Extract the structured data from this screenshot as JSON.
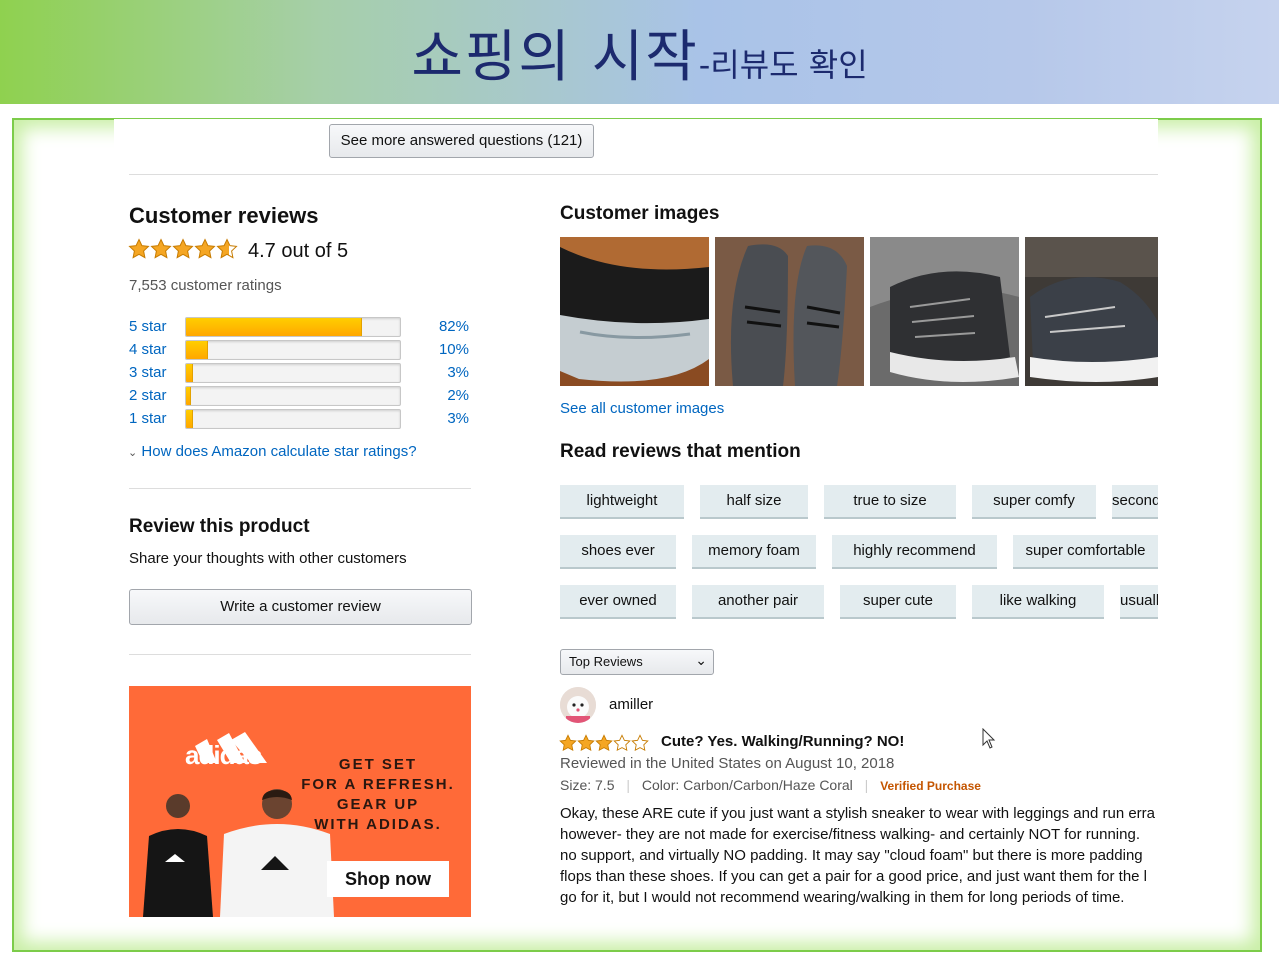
{
  "banner": {
    "title_main": "쇼핑의 시작",
    "title_sub": "-리뷰도 확인"
  },
  "qa": {
    "button_label": "See more answered questions (121)"
  },
  "reviews": {
    "heading": "Customer reviews",
    "rating_text": "4.7 out of 5",
    "rating_value": 4.7,
    "ratings_count": "7,553 customer ratings",
    "histogram": [
      {
        "label": "5 star",
        "pct": "82%",
        "value": 82
      },
      {
        "label": "4 star",
        "pct": "10%",
        "value": 10
      },
      {
        "label": "3 star",
        "pct": "3%",
        "value": 3
      },
      {
        "label": "2 star",
        "pct": "2%",
        "value": 2
      },
      {
        "label": "1 star",
        "pct": "3%",
        "value": 3
      }
    ],
    "how_link": "How does Amazon calculate star ratings?"
  },
  "review_product": {
    "heading": "Review this product",
    "subtext": "Share your thoughts with other customers",
    "button_label": "Write a customer review"
  },
  "ad": {
    "brand": "adidas",
    "lines": [
      "GET SET",
      "FOR A REFRESH.",
      "GEAR UP",
      "WITH ADIDAS."
    ],
    "cta": "Shop now",
    "brand_color": "#ff6a38"
  },
  "images": {
    "heading": "Customer images",
    "see_all": "See all customer images"
  },
  "mentions": {
    "heading": "Read reviews that mention",
    "chips": [
      [
        "lightweight",
        "half size",
        "true to size",
        "super comfy",
        "second pair"
      ],
      [
        "shoes ever",
        "memory foam",
        "highly recommend",
        "super comfortable"
      ],
      [
        "ever owned",
        "another pair",
        "super cute",
        "like walking",
        "usually wear"
      ]
    ]
  },
  "sort": {
    "selected": "Top Reviews"
  },
  "review": {
    "author": "amiller",
    "rating_value": 3,
    "title": "Cute? Yes. Walking/Running? NO!",
    "meta": "Reviewed in the United States on August 10, 2018",
    "size": "Size: 7.5",
    "color": "Color: Carbon/Carbon/Haze Coral",
    "verified": "Verified Purchase",
    "body": [
      "Okay, these ARE cute if you just want a stylish sneaker to wear with leggings and run erra",
      "however- they are not made for exercise/fitness walking- and certainly NOT for running. ",
      "no support, and virtually NO padding. It may say \"cloud foam\" but there is more padding",
      "flops than these shoes. If you can get a pair for a good price, and just want them for the l",
      "go for it, but I would not recommend wearing/walking in them for long periods of time."
    ]
  }
}
